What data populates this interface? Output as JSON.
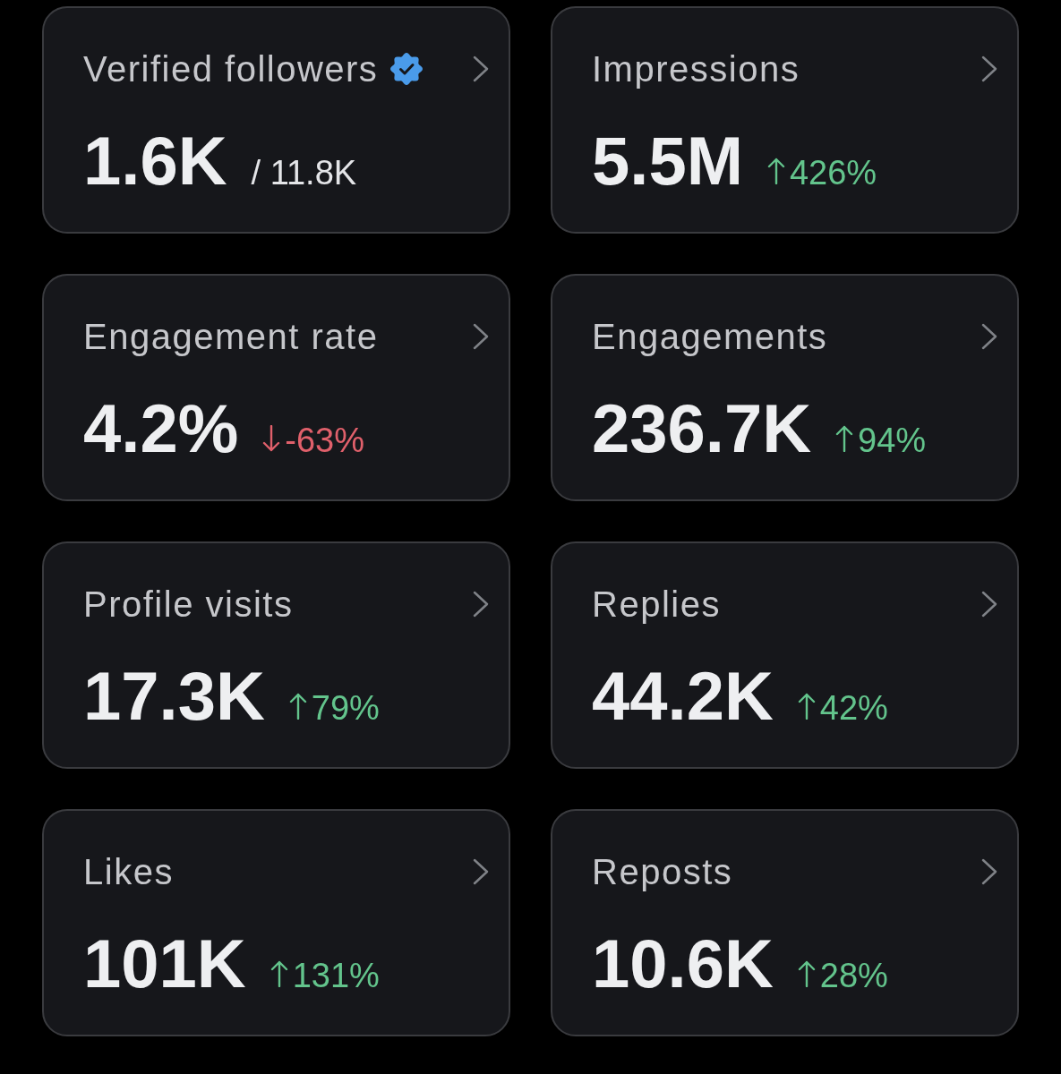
{
  "cards": [
    {
      "title": "Verified followers",
      "verified": true,
      "value": "1.6K",
      "total": "/ 11.8K"
    },
    {
      "title": "Impressions",
      "verified": false,
      "value": "5.5M",
      "change": {
        "rising": true,
        "text": "426%"
      }
    },
    {
      "title": "Engagement rate",
      "verified": false,
      "value": "4.2%",
      "change": {
        "rising": false,
        "text": "-63%"
      }
    },
    {
      "title": "Engagements",
      "verified": false,
      "value": "236.7K",
      "change": {
        "rising": true,
        "text": "94%"
      }
    },
    {
      "title": "Profile visits",
      "verified": false,
      "value": "17.3K",
      "change": {
        "rising": true,
        "text": "79%"
      }
    },
    {
      "title": "Replies",
      "verified": false,
      "value": "44.2K",
      "change": {
        "rising": true,
        "text": "42%"
      }
    },
    {
      "title": "Likes",
      "verified": false,
      "value": "101K",
      "change": {
        "rising": true,
        "text": "131%"
      }
    },
    {
      "title": "Reposts",
      "verified": false,
      "value": "10.6K",
      "change": {
        "rising": true,
        "text": "28%"
      }
    }
  ]
}
